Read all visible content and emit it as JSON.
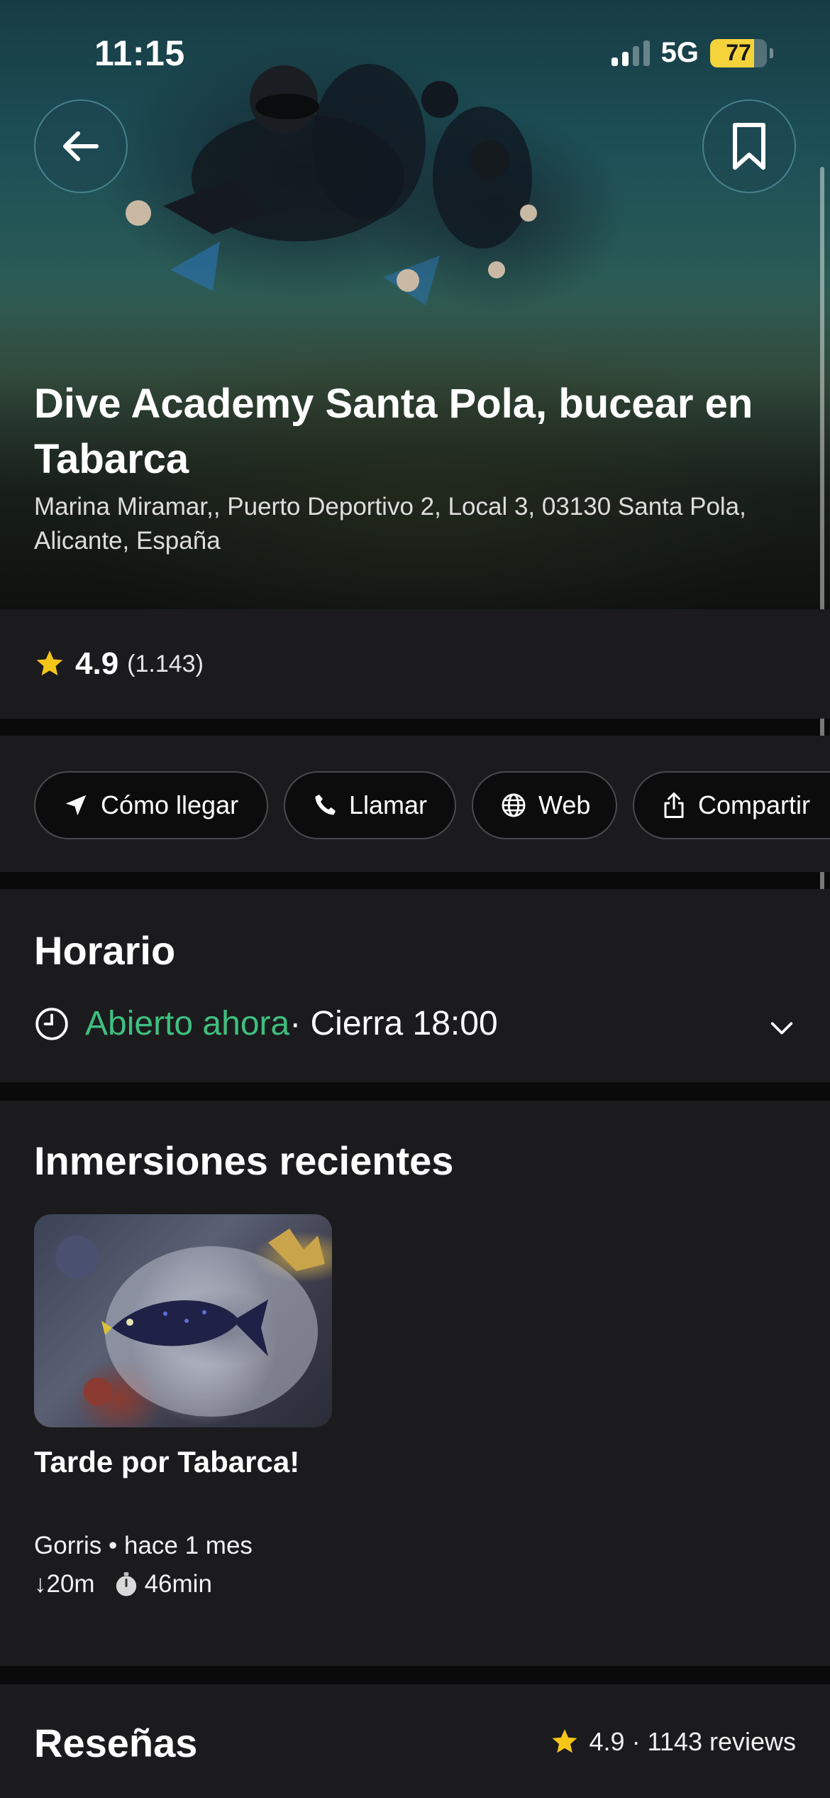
{
  "status_bar": {
    "time": "11:15",
    "network": "5G",
    "battery": "77",
    "battery_level": 0.77
  },
  "header": {
    "back_icon": "arrow-left-icon",
    "save_icon": "bookmark-icon"
  },
  "place": {
    "title": "Dive Academy Santa Pola, bucear en Tabarca",
    "address": "Marina Miramar,, Puerto Deportivo 2, Local 3, 03130 Santa Pola, Alicante, España",
    "rating": "4.9",
    "rating_count": "(1.143)"
  },
  "actions": [
    {
      "label": "Cómo llegar",
      "icon": "navigation-arrow-icon"
    },
    {
      "label": "Llamar",
      "icon": "phone-icon"
    },
    {
      "label": "Web",
      "icon": "globe-icon"
    },
    {
      "label": "Compartir",
      "icon": "share-icon"
    }
  ],
  "hours": {
    "title": "Horario",
    "status": "Abierto ahora",
    "closes": " · Cierra 18:00",
    "status_color": "#3fbf7f"
  },
  "recent_dives": {
    "title": "Inmersiones recientes",
    "items": [
      {
        "title": "Tarde por Tabarca!",
        "meta": "Gorris • hace 1 mes",
        "depth": "↓20m",
        "duration": "46min"
      }
    ]
  },
  "reviews": {
    "title": "Reseñas",
    "summary": "4.9 · 1143 reviews"
  },
  "colors": {
    "accent_star": "#f5c518",
    "open_green": "#3fbf7f",
    "section_bg": "#1b1b1e",
    "page_bg": "#0a0a0b"
  }
}
